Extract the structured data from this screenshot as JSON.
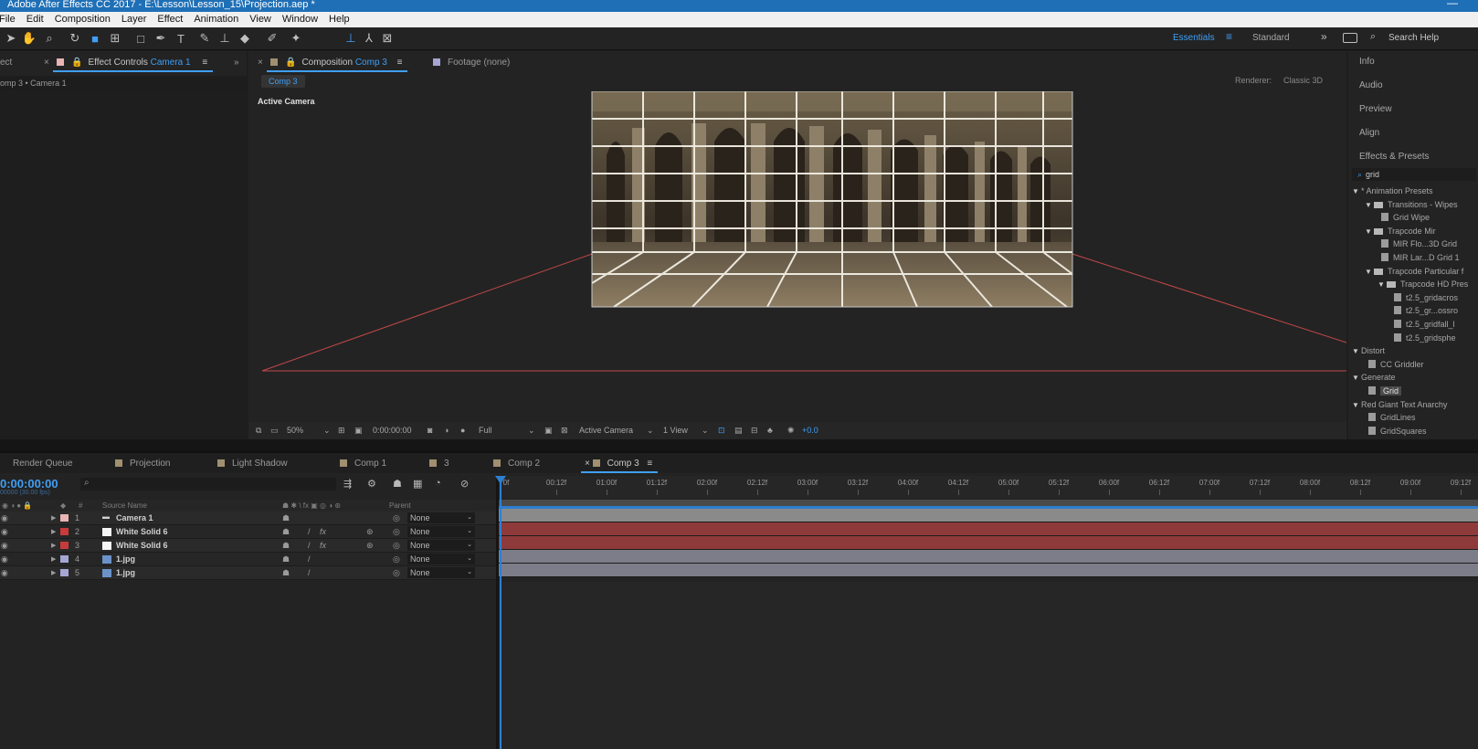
{
  "window": {
    "title": "Adobe After Effects CC 2017 - E:\\Lesson\\Lesson_15\\Projection.aep *",
    "minimize": "—"
  },
  "menu": [
    "File",
    "Edit",
    "Composition",
    "Layer",
    "Effect",
    "Animation",
    "View",
    "Window",
    "Help"
  ],
  "toolbar": {
    "workspace_active": "Essentials",
    "workspace_menu": "≡",
    "workspace_other": "Standard",
    "more": "»",
    "search_placeholder": "Search Help"
  },
  "left_panel": {
    "tab_project": "ect",
    "tab_effect_controls_prefix": "Effect Controls",
    "tab_effect_controls_target": "Camera 1",
    "breadcrumb": "omp 3 • Camera 1"
  },
  "comp_panel": {
    "tab_prefix": "Composition",
    "tab_name": "Comp 3",
    "footage_tab": "Footage (none)",
    "subtab": "Comp 3",
    "renderer_label": "Renderer:",
    "renderer_value": "Classic 3D",
    "view_label": "Active Camera",
    "viewer_bar": {
      "zoom": "50%",
      "timecode": "0:00:00:00",
      "resolution": "Full",
      "camera": "Active Camera",
      "views": "1 View",
      "exposure": "+0.0"
    }
  },
  "right_panel": {
    "sections": [
      "Info",
      "Audio",
      "Preview",
      "Align",
      "Effects & Presets"
    ],
    "search_value": "grid",
    "tree": [
      {
        "label": "* Animation Presets",
        "indent": 0,
        "kind": "tri"
      },
      {
        "label": "Transitions - Wipes",
        "indent": 1,
        "kind": "folder"
      },
      {
        "label": "Grid Wipe",
        "indent": 2,
        "kind": "file"
      },
      {
        "label": "Trapcode Mir",
        "indent": 1,
        "kind": "folder"
      },
      {
        "label": "MIR Flo...3D Grid",
        "indent": 2,
        "kind": "file"
      },
      {
        "label": "MIR Lar...D Grid 1",
        "indent": 2,
        "kind": "file"
      },
      {
        "label": "Trapcode Particular f",
        "indent": 1,
        "kind": "folder"
      },
      {
        "label": "Trapcode HD Pres",
        "indent": 2,
        "kind": "folder"
      },
      {
        "label": "t2.5_gridacros",
        "indent": 3,
        "kind": "file"
      },
      {
        "label": "t2.5_gr...ossro",
        "indent": 3,
        "kind": "file"
      },
      {
        "label": "t2.5_gridfall_l",
        "indent": 3,
        "kind": "file"
      },
      {
        "label": "t2.5_gridsphe",
        "indent": 3,
        "kind": "file"
      },
      {
        "label": "Distort",
        "indent": 0,
        "kind": "tri"
      },
      {
        "label": "CC Griddler",
        "indent": 1,
        "kind": "file"
      },
      {
        "label": "Generate",
        "indent": 0,
        "kind": "tri"
      },
      {
        "label": "Grid",
        "indent": 1,
        "kind": "file",
        "selected": true
      },
      {
        "label": "Red Giant Text Anarchy",
        "indent": 0,
        "kind": "tri"
      },
      {
        "label": "GridLines",
        "indent": 1,
        "kind": "file"
      },
      {
        "label": "GridSquares",
        "indent": 1,
        "kind": "file"
      }
    ]
  },
  "timeline": {
    "tabs": [
      {
        "label": "Render Queue",
        "color": ""
      },
      {
        "label": "Projection",
        "color": "#a09070"
      },
      {
        "label": "Light Shadow",
        "color": "#a09070"
      },
      {
        "label": "Comp 1",
        "color": "#a09070"
      },
      {
        "label": "3",
        "color": "#a09070"
      },
      {
        "label": "Comp 2",
        "color": "#a09070"
      },
      {
        "label": "Comp 3",
        "color": "#a09070",
        "active": true
      }
    ],
    "timecode": "0:00:00:00",
    "timecode_sub": "00000 (30.00 fps)",
    "header": {
      "source_name": "Source Name",
      "parent": "Parent",
      "num": "#"
    },
    "layers": [
      {
        "num": "1",
        "name": "Camera 1",
        "color": "#e8b4b4",
        "type": "camera",
        "track": "#8a8a8a",
        "parent": "None",
        "fx": false
      },
      {
        "num": "2",
        "name": "White Solid 6",
        "color": "#c73b3b",
        "type": "solid",
        "track": "#8f3a3a",
        "parent": "None",
        "fx": true
      },
      {
        "num": "3",
        "name": "White Solid 6",
        "color": "#c73b3b",
        "type": "solid",
        "track": "#8f3a3a",
        "parent": "None",
        "fx": true
      },
      {
        "num": "4",
        "name": "1.jpg",
        "color": "#a6a6d4",
        "type": "image",
        "track": "#7d7d8a",
        "parent": "None",
        "fx": false
      },
      {
        "num": "5",
        "name": "1.jpg",
        "color": "#a6a6d4",
        "type": "image",
        "track": "#7d7d8a",
        "parent": "None",
        "fx": false
      }
    ],
    "ruler": [
      "00:12f",
      "01:00f",
      "01:12f",
      "02:00f",
      "02:12f",
      "03:00f",
      "03:12f",
      "04:00f",
      "04:12f",
      "05:00f",
      "05:12f",
      "06:00f",
      "06:12f",
      "07:00f",
      "07:12f",
      "08:00f",
      "08:12f",
      "09:00f",
      "09:12f"
    ],
    "ruler_start": "0f"
  }
}
